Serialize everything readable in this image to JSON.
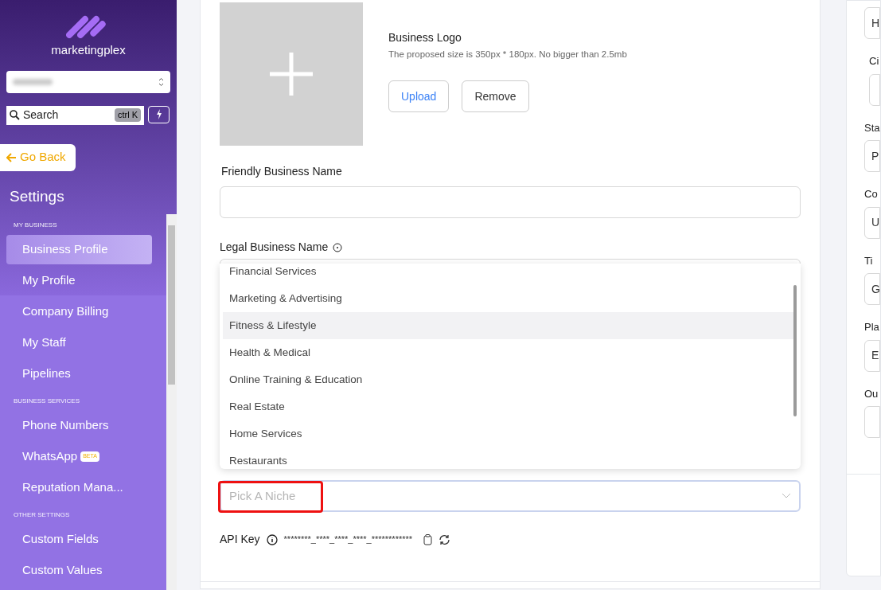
{
  "sidebar": {
    "brand": "marketingplex",
    "search": {
      "placeholder": "Search",
      "shortcut": "ctrl K"
    },
    "back_button": "Go Back",
    "title": "Settings",
    "sections": [
      {
        "heading": "MY BUSINESS",
        "items": [
          {
            "label": "Business Profile",
            "selected": true
          },
          {
            "label": "My Profile",
            "selected": false
          },
          {
            "label": "Company Billing",
            "selected": false
          },
          {
            "label": "My Staff",
            "selected": false
          },
          {
            "label": "Pipelines",
            "selected": false
          }
        ]
      },
      {
        "heading": "BUSINESS SERVICES",
        "items": [
          {
            "label": "Phone Numbers",
            "selected": false
          },
          {
            "label": "WhatsApp",
            "badge": "BETA",
            "selected": false
          },
          {
            "label": "Reputation Mana...",
            "selected": false
          }
        ]
      },
      {
        "heading": "OTHER SETTINGS",
        "items": [
          {
            "label": "Custom Fields",
            "selected": false
          },
          {
            "label": "Custom Values",
            "selected": false
          }
        ]
      }
    ]
  },
  "logo_upload": {
    "title": "Business Logo",
    "hint": "The proposed size is 350px * 180px. No bigger than 2.5mb",
    "buttons": [
      "Upload",
      "Remove"
    ]
  },
  "friendly_name": {
    "label": "Friendly Business Name"
  },
  "legal_name": {
    "label": "Legal Business Name"
  },
  "niche_dropdown": {
    "options": [
      {
        "label": "Financial Services",
        "selected": false
      },
      {
        "label": "Marketing & Advertising",
        "selected": false
      },
      {
        "label": "Fitness & Lifestyle",
        "selected": true
      },
      {
        "label": "Health & Medical",
        "selected": false
      },
      {
        "label": "Online Training & Education",
        "selected": false
      },
      {
        "label": "Real Estate",
        "selected": false
      },
      {
        "label": "Home Services",
        "selected": false
      },
      {
        "label": "Restaurants",
        "selected": false
      }
    ]
  },
  "niche_select": {
    "placeholder": "Pick A Niche",
    "highlighted": true
  },
  "api_key": {
    "label": "API Key",
    "value": "********_****_****_****_************"
  },
  "right_panel": {
    "fields": [
      {
        "value": "H"
      },
      {
        "label": "Ci"
      },
      {
        "label": "Sta",
        "value": "P"
      },
      {
        "label": "Co",
        "value": "U"
      },
      {
        "label": "Ti",
        "value": "G"
      },
      {
        "label": "Pla",
        "value": "E"
      },
      {
        "label": "Ou"
      }
    ]
  }
}
